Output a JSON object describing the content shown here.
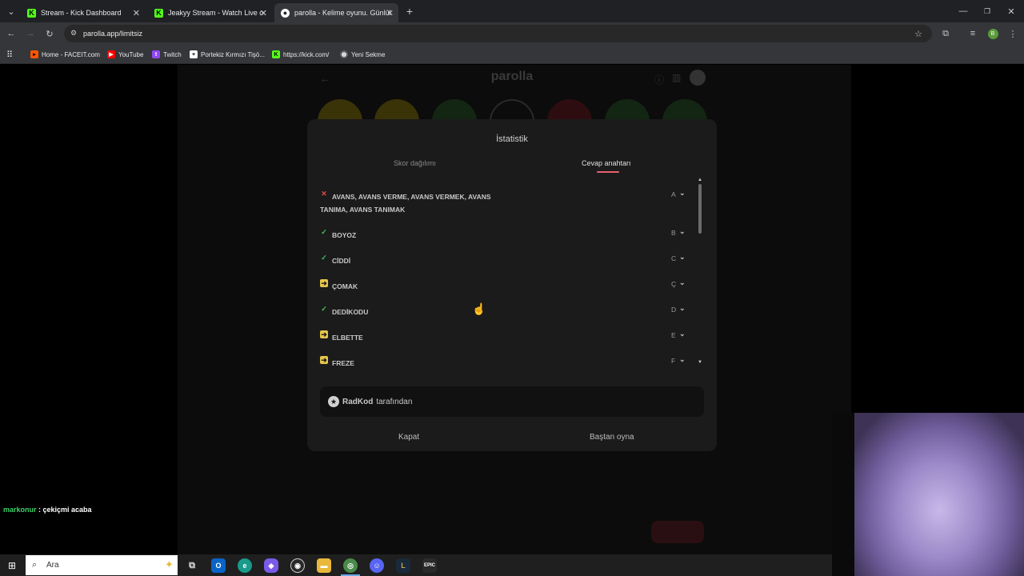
{
  "browser": {
    "tabs": [
      {
        "title": "Stream - Kick Dashboard",
        "icon": "kick-icon",
        "active": false
      },
      {
        "title": "Jeakyy Stream - Watch Live on",
        "icon": "kick-icon",
        "active": false
      },
      {
        "title": "parolla - Kelime oyunu. Günlük",
        "icon": "parolla-icon",
        "active": true
      }
    ],
    "new_tab": "+",
    "address": "parolla.app/limitsiz",
    "bookmarks": [
      {
        "label": "Home - FACEIT.com",
        "icon": "faceit-icon"
      },
      {
        "label": "YouTube",
        "icon": "youtube-icon"
      },
      {
        "label": "Twitch",
        "icon": "twitch-icon"
      },
      {
        "label": "Portekiz Kırmızı Tişö...",
        "icon": "plus-icon"
      },
      {
        "label": "https://kick.com/",
        "icon": "kick-icon"
      },
      {
        "label": "Yeni Sekme",
        "icon": "globe-icon"
      }
    ],
    "profile_initial": "B"
  },
  "app": {
    "title": "parolla"
  },
  "modal": {
    "title": "İstatistik",
    "tabs": {
      "score": "Skor dağılımı",
      "answers": "Cevap anahtarı"
    },
    "answers": [
      {
        "status": "wrong",
        "word": "AVANS, AVANS VERME, AVANS VERMEK, AVANS TANIMA, AVANS TANIMAK",
        "letter": "A"
      },
      {
        "status": "correct",
        "word": "BOYOZ",
        "letter": "B"
      },
      {
        "status": "correct",
        "word": "CİDDİ",
        "letter": "C"
      },
      {
        "status": "passed",
        "word": "ÇOMAK",
        "letter": "Ç"
      },
      {
        "status": "correct",
        "word": "DEDİKODU",
        "letter": "D"
      },
      {
        "status": "passed",
        "word": "ELBETTE",
        "letter": "E"
      },
      {
        "status": "passed",
        "word": "FREZE",
        "letter": "F"
      }
    ],
    "author": {
      "name": "RadKod",
      "suffix": "tarafından"
    },
    "close_label": "Kapat",
    "restart_label": "Baştan oyna"
  },
  "chat": {
    "user": "markonur",
    "message": " : çekiçmi acaba"
  },
  "taskbar": {
    "search_placeholder": "Ara",
    "apps": [
      "task-view-icon",
      "outlook-icon",
      "edge-icon",
      "copilot-icon",
      "obs-icon",
      "file-explorer-icon",
      "chrome-icon",
      "discord-icon",
      "league-icon",
      "epic-games-icon"
    ]
  },
  "colors": {
    "accent_underline": "#e8616d",
    "correct": "#45c45c",
    "wrong": "#e04a4a",
    "passed": "#e5c54a",
    "chat_user": "#3bd26b"
  }
}
